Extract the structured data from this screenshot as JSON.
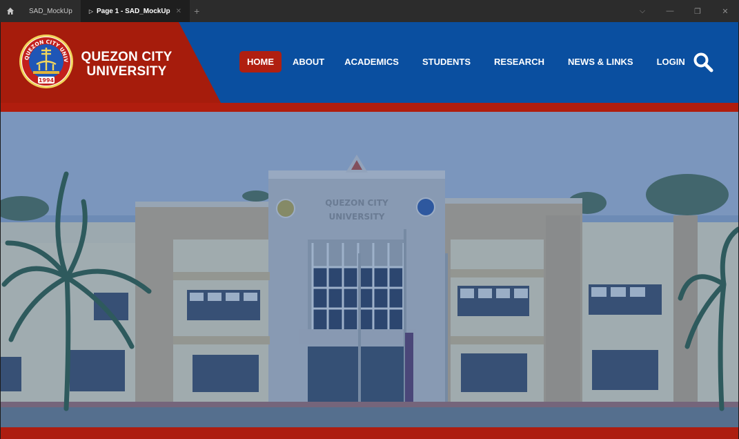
{
  "window": {
    "tabs": [
      {
        "label": "SAD_MockUp"
      },
      {
        "label": "Page 1 - SAD_MockUp"
      }
    ],
    "controls": {
      "chevron": "⌵",
      "minimize": "—",
      "restore": "❐",
      "close": "✕"
    }
  },
  "site": {
    "name_line1": "QUEZON CITY",
    "name_line2": "UNIVERSITY",
    "logo": {
      "ring_text": "QUEZON CITY UNIVERSITY",
      "year": "1994"
    }
  },
  "nav": {
    "items": [
      {
        "label": "HOME",
        "active": true
      },
      {
        "label": "ABOUT"
      },
      {
        "label": "ACADEMICS"
      },
      {
        "label": "STUDENTS"
      },
      {
        "label": "RESEARCH"
      },
      {
        "label": "NEWS & LINKS"
      },
      {
        "label": "LOGIN"
      }
    ]
  },
  "hero": {
    "building_sign_line1": "QUEZON CITY",
    "building_sign_line2": "UNIVERSITY"
  },
  "colors": {
    "brand_red": "#a61c0c",
    "brand_blue": "#0a4fa0",
    "hero_tint": "#2f5b9a"
  },
  "icons": {
    "home": "home-icon",
    "search": "search-icon"
  }
}
